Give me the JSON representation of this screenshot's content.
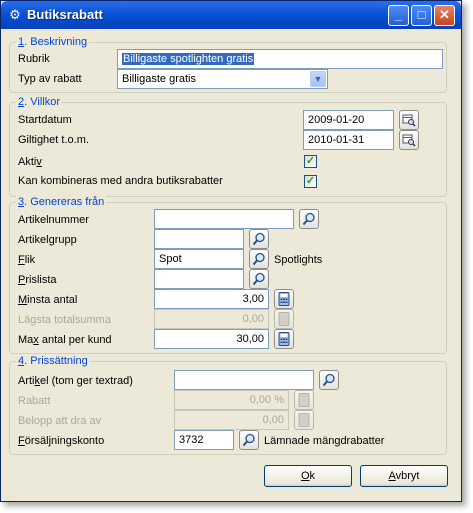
{
  "window": {
    "title": "Butiksrabatt",
    "app_icon": "gears-icon",
    "minimize": "_",
    "maximize": "□",
    "close": "✕"
  },
  "beskrivning": {
    "legend_num": "1",
    "legend_text": ". Beskrivning",
    "rubrik_label": "Rubrik",
    "rubrik_value": "Billigaste spotlighten gratis",
    "typ_label": "Typ av rabatt",
    "typ_value": "Billigaste gratis"
  },
  "villkor": {
    "legend_num": "2",
    "legend_text": ". Villkor",
    "startdatum_label": "Startdatum",
    "startdatum_value": "2009-01-20",
    "giltighet_label": "Giltighet t.o.m.",
    "giltighet_value": "2010-01-31",
    "aktiv_label_a": "Akti",
    "aktiv_label_u": "v",
    "aktiv_checked": true,
    "kombineras_label": "Kan kombineras med andra butiksrabatter",
    "kombineras_checked": true
  },
  "genereras": {
    "legend_num": "3",
    "legend_text": ". Genereras från",
    "artikelnummer_label": "Artikelnummer",
    "artikelnummer_value": "",
    "artikelgrupp_label_a": "Artikel",
    "artikelgrupp_label_u": "g",
    "artikelgrupp_label_b": "rupp",
    "artikelgrupp_value": "",
    "flik_label_u": "F",
    "flik_label_b": "lik",
    "flik_value": "Spot",
    "flik_desc": "Spotlights",
    "prislista_label_u": "P",
    "prislista_label_b": "rislista",
    "prislista_value": "",
    "minsta_label_u": "M",
    "minsta_label_b": "insta antal",
    "minsta_value": "3,00",
    "lagsta_label": "Lägsta totalsumma",
    "lagsta_value": "0,00",
    "max_label_a": "Ma",
    "max_label_u": "x",
    "max_label_b": " antal per kund",
    "max_value": "30,00"
  },
  "prissattning": {
    "legend_num": "4",
    "legend_text": ". Prissättning",
    "artikel_label_a": "Arti",
    "artikel_label_u": "k",
    "artikel_label_b": "el (tom ger textrad)",
    "artikel_value": "",
    "rabatt_label": "Rabatt",
    "rabatt_value": "0,00 %",
    "belopp_label": "Belopp att dra av",
    "belopp_value": "0,00",
    "konto_label_u": "F",
    "konto_label_b": "örsäljningskonto",
    "konto_value": "3732",
    "konto_desc": "Lämnade mängdrabatter"
  },
  "buttons": {
    "ok_u": "O",
    "ok_b": "k",
    "avbryt_u": "A",
    "avbryt_b": "vbryt"
  }
}
